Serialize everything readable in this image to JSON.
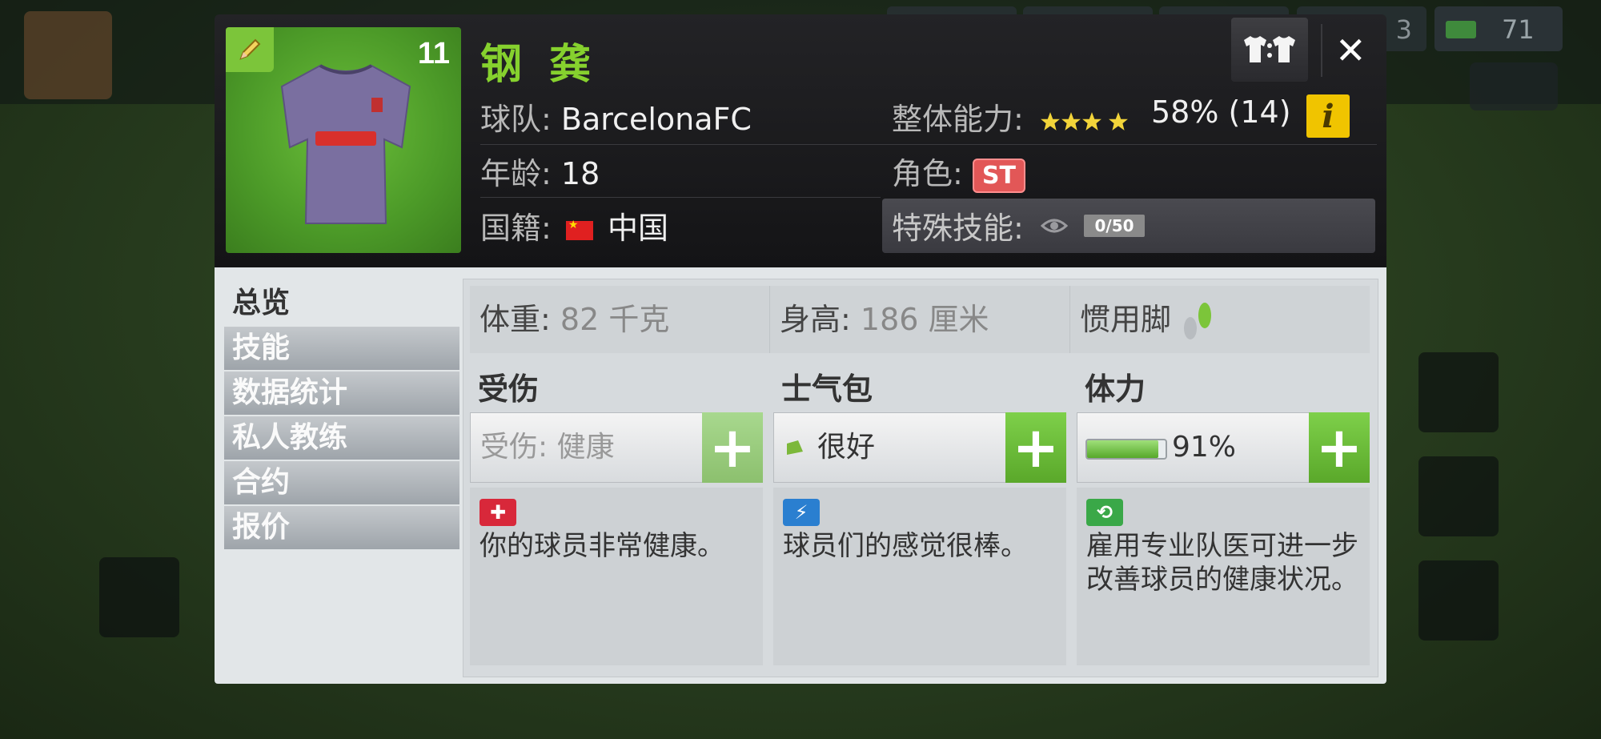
{
  "background": {
    "money": "71",
    "resource_partial": "3"
  },
  "player": {
    "jersey_number": "11",
    "name": "钢 龚",
    "kit_swap_label": "T:T"
  },
  "info": {
    "team_label": "球队:",
    "team_value": "BarcelonaFC",
    "overall_label": "整体能力:",
    "overall_stars": 3.5,
    "overall_value": "58% (14)",
    "age_label": "年龄:",
    "age_value": "18",
    "role_label": "角色:",
    "role_value": "ST",
    "nationality_label": "国籍:",
    "nationality_value": "中国",
    "special_label": "特殊技能:",
    "special_count": "0/50"
  },
  "tabs": [
    "总览",
    "技能",
    "数据统计",
    "私人教练",
    "合约",
    "报价"
  ],
  "stats": {
    "weight_label": "体重:",
    "weight_value": "82 千克",
    "height_label": "身高:",
    "height_value": "186 厘米",
    "foot_label": "惯用脚"
  },
  "injury": {
    "title": "受伤",
    "status_label": "受伤:",
    "status_value": "健康",
    "desc": "你的球员非常健康。"
  },
  "morale": {
    "title": "士气包",
    "value": "很好",
    "desc": "球员们的感觉很棒。"
  },
  "stamina": {
    "title": "体力",
    "percent": 91,
    "value": "91%",
    "desc": "雇用专业队医可进一步改善球员的健康状况。"
  },
  "colors": {
    "accent_green": "#86d12e",
    "plus_green": "#5aa82a",
    "role_red": "#e25757",
    "info_yellow": "#f0c400"
  }
}
